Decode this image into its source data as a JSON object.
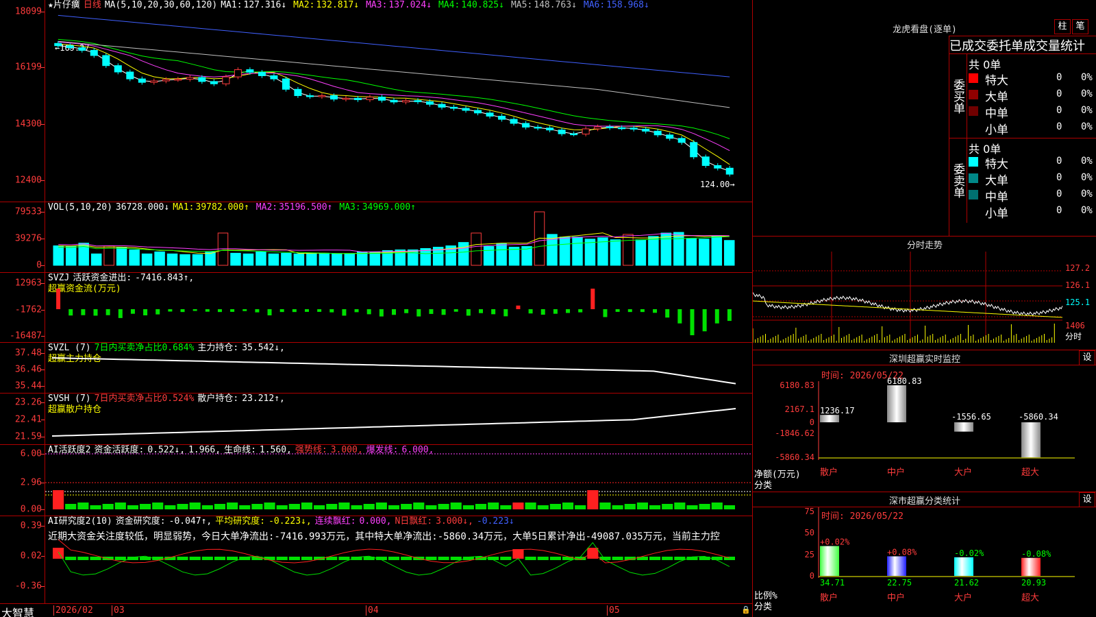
{
  "kline": {
    "star_name": "★片仔癀",
    "period": "日线",
    "ma_title": "MA(5,10,20,30,60,120)",
    "ma": [
      {
        "label": "MA1:",
        "value": "127.316↓",
        "color": "#ffffff"
      },
      {
        "label": "MA2:",
        "value": "132.817↓",
        "color": "#ffff00"
      },
      {
        "label": "MA3:",
        "value": "137.024↓",
        "color": "#ff40ff"
      },
      {
        "label": "MA4:",
        "value": "140.825↓",
        "color": "#00ff00"
      },
      {
        "label": "MA5:",
        "value": "148.763↓",
        "color": "#c0c0c0"
      },
      {
        "label": "MA6:",
        "value": "158.968↓",
        "color": "#4060ff"
      }
    ],
    "y_labels": [
      "18099",
      "16199",
      "14300",
      "12400"
    ],
    "hi_label": "169.27",
    "lo_label": "124.00"
  },
  "vol": {
    "title": "VOL(5,10,20)",
    "value": "36728.000↓",
    "ma": [
      {
        "label": "MA1:",
        "value": "39782.000↑",
        "color": "#ffff00"
      },
      {
        "label": "MA2:",
        "value": "35196.500↑",
        "color": "#ff40ff"
      },
      {
        "label": "MA3:",
        "value": "34969.000↑",
        "color": "#00ff00"
      }
    ],
    "y_labels": [
      "79533",
      "39276",
      "0"
    ]
  },
  "svzj": {
    "title": "SVZJ",
    "label": "活跃资金进出:",
    "value": "-7416.843↑,",
    "sub": "超赢资金流(万元)",
    "y_labels": [
      "12963",
      "-1762",
      "-16487"
    ]
  },
  "svzl": {
    "title": "SVZL (7)",
    "label1": "7日内买卖净占比0.684%",
    "label2": "主力持仓:",
    "value": "35.542↓,",
    "sub": "超赢主力持仓",
    "y_labels": [
      "37.48",
      "36.46",
      "35.44"
    ]
  },
  "svsh": {
    "title": "SVSH (7)",
    "label1": "7日内买卖净占比0.524%",
    "label2": "散户持仓:",
    "value": "23.212↑,",
    "sub": "超赢散户持仓",
    "y_labels": [
      "23.26",
      "22.41",
      "21.59"
    ]
  },
  "ai1": {
    "title": "AI活跃度2",
    "label": "资金活跃度:",
    "v1": "0.522↓,",
    "v2": "1.966,",
    "label2": "生命线:",
    "v3": "1.560,",
    "label3": "强势线:",
    "v4": "3.000,",
    "label4": "爆发线:",
    "v5": "6.000,",
    "y_labels": [
      "6.00",
      "2.96",
      "0.00"
    ]
  },
  "ai2": {
    "title": "AI研究度2(10)",
    "label": "资金研究度:",
    "v1": "-0.047↑,",
    "label2": "平均研究度:",
    "v2": "-0.223↓,",
    "label3": "连续飘红:",
    "v3": "0.000,",
    "label4": "N日飘红:",
    "v4": "3.000↓,",
    "v5": "-0.223↓",
    "comment": "近期大资金关注度较低，明显弱势，今日大单净流出:-7416.993万元，其中特大单净流出:-5860.34万元，大单5日累计净出-49087.035万元，当前主力控",
    "y_labels": [
      "0.39",
      "0.02",
      "-0.36"
    ]
  },
  "bottom": {
    "brand": "大智慧",
    "date0": "2026/02",
    "m3": "03",
    "m4": "04",
    "m5": "05"
  },
  "longhu": {
    "title": "龙虎看盘(逐单)",
    "btn1": "柱",
    "btn2": "笔",
    "header": "已成交委托单成交量统计",
    "buy_side": "委买单",
    "sell_side": "委卖单",
    "buy_total": "共 0单",
    "sell_total": "共 0单",
    "buy_rows": [
      {
        "name": "特大",
        "count": "0",
        "pct": "0%",
        "color": "#ff0000"
      },
      {
        "name": "大单",
        "count": "0",
        "pct": "0%",
        "color": "#900000"
      },
      {
        "name": "中单",
        "count": "0",
        "pct": "0%",
        "color": "#700000"
      },
      {
        "name": "小单",
        "count": "0",
        "pct": "0%",
        "color": "#000000"
      }
    ],
    "sell_rows": [
      {
        "name": "特大",
        "count": "0",
        "pct": "0%",
        "color": "#00ffff"
      },
      {
        "name": "大单",
        "count": "0",
        "pct": "0%",
        "color": "#008888"
      },
      {
        "name": "中单",
        "count": "0",
        "pct": "0%",
        "color": "#007070"
      },
      {
        "name": "小单",
        "count": "0",
        "pct": "0%",
        "color": "#000000"
      }
    ]
  },
  "fenshi": {
    "title": "分时走势",
    "y": [
      "127.2",
      "126.1",
      "125.1",
      "1406"
    ],
    "footer": "分时"
  },
  "szmon": {
    "title": "深圳超赢实时监控",
    "btn": "设",
    "date": "时间: 2026/05/22",
    "y": [
      "6180.83",
      "2167.1",
      "0",
      "-1846.62",
      "-5860.34"
    ],
    "axis_title": "净额(万元)",
    "axis_sub": "分类",
    "bars": [
      {
        "cat": "散户",
        "value": 1236.17,
        "label": "1236.17"
      },
      {
        "cat": "中户",
        "value": 6180.83,
        "label": "6180.83"
      },
      {
        "cat": "大户",
        "value": -1556.65,
        "label": "-1556.65"
      },
      {
        "cat": "超大",
        "value": -5860.34,
        "label": "-5860.34"
      }
    ]
  },
  "szcls": {
    "title": "深市超赢分类统计",
    "btn": "设",
    "date": "时间: 2026/05/22",
    "y": [
      "75",
      "50",
      "25",
      "0"
    ],
    "axis_title": "比例%",
    "axis_sub": "分类",
    "bars": [
      {
        "cat": "散户",
        "value": 34.71,
        "label": "34.71",
        "chg": "+0.02%",
        "color": "#40ff40"
      },
      {
        "cat": "中户",
        "value": 22.75,
        "label": "22.75",
        "chg": "+0.08%",
        "color": "#2020ff"
      },
      {
        "cat": "大户",
        "value": 21.62,
        "label": "21.62",
        "chg": "-0.02%",
        "color": "#00ffff"
      },
      {
        "cat": "超大",
        "value": 20.93,
        "label": "20.93",
        "chg": "-0.08%",
        "color": "#ff2020"
      }
    ]
  },
  "chart_data": {
    "type": "candlestick",
    "closes": [
      168.5,
      167.8,
      166.9,
      165.1,
      161.6,
      159.4,
      157.0,
      155.8,
      156.3,
      156.8,
      156.9,
      157.5,
      156.1,
      155.3,
      157.7,
      160.2,
      159.3,
      158.1,
      157.0,
      153.4,
      151.2,
      150.9,
      151.2,
      150.0,
      150.3,
      149.8,
      150.7,
      149.6,
      149.0,
      149.5,
      149.1,
      148.2,
      147.2,
      146.8,
      146.1,
      145.2,
      144.1,
      143.0,
      141.6,
      140.3,
      140.0,
      139.3,
      138.0,
      137.9,
      139.7,
      140.4,
      140.1,
      140.0,
      139.6,
      138.9,
      137.6,
      136.4,
      135.0,
      130.0,
      127.0,
      126.1,
      124.0
    ],
    "volume": [
      29000,
      28000,
      33000,
      17000,
      29000,
      27000,
      23000,
      17000,
      20000,
      17000,
      16000,
      16000,
      20000,
      48000,
      18000,
      17000,
      20000,
      17000,
      18000,
      17000,
      18000,
      18000,
      17000,
      17000,
      20000,
      20000,
      22000,
      23000,
      23000,
      25000,
      27000,
      29000,
      34000,
      48000,
      28000,
      32000,
      27000,
      28000,
      79533,
      46000,
      42000,
      42000,
      39000,
      41000,
      38000,
      46000,
      38000,
      43000,
      48000,
      49000,
      40000,
      39000,
      44000,
      37000
    ],
    "svzj": [
      12963,
      -4000,
      -3800,
      -4100,
      -3800,
      -5600,
      -2900,
      -3900,
      -3300,
      -1500,
      -1800,
      -1100,
      -1600,
      -1800,
      -1700,
      -1200,
      -2000,
      -3900,
      -1800,
      -1800,
      -1700,
      -1700,
      -2000,
      -4100,
      -1900,
      -3200,
      -4600,
      -3600,
      -2500,
      -4600,
      -3000,
      -3600,
      -1600,
      -4100,
      -2500,
      -3200,
      -4500,
      2300,
      -2700,
      -3500,
      -2900,
      -2400,
      -2000,
      13000,
      -5000,
      -1700,
      -1800,
      -1800,
      -2300,
      -5300,
      -9000,
      -16487,
      -14000,
      -9000,
      -7416
    ]
  }
}
